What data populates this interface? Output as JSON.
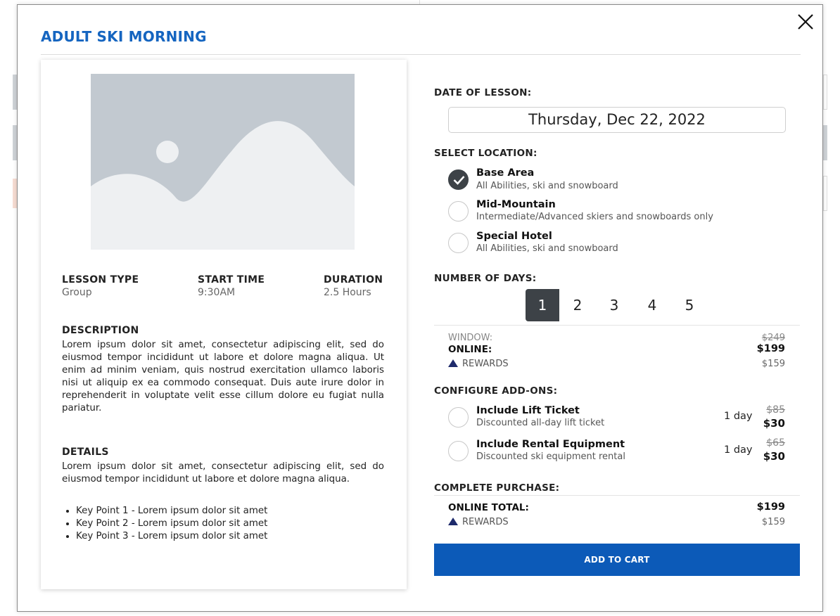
{
  "modal": {
    "title": "ADULT SKI MORNING"
  },
  "lesson": {
    "lesson_type_label": "LESSON TYPE",
    "lesson_type": "Group",
    "start_time_label": "START TIME",
    "start_time": "9:30AM",
    "duration_label": "DURATION",
    "duration": "2.5 Hours",
    "description_label": "DESCRIPTION",
    "description": "Lorem ipsum dolor sit amet, consectetur adipiscing elit, sed do eiusmod tempor incididunt ut labore et dolore magna aliqua. Ut enim ad minim veniam, quis nostrud exercitation ullamco laboris nisi ut aliquip ex ea commodo consequat. Duis aute irure dolor in reprehenderit in voluptate velit esse cillum dolore eu fugiat nulla pariatur.",
    "details_label": "DETAILS",
    "details": "Lorem ipsum dolor sit amet, consectetur adipiscing elit, sed do eiusmod tempor incididunt ut labore et dolore magna aliqua.",
    "key_points": [
      "Key Point 1 - Lorem ipsum dolor sit amet",
      "Key Point 2 - Lorem ipsum dolor sit amet",
      "Key Point 3 - Lorem ipsum dolor sit amet"
    ]
  },
  "date": {
    "label": "DATE OF LESSON:",
    "value": "Thursday, Dec 22, 2022"
  },
  "location": {
    "label": "SELECT LOCATION:",
    "options": [
      {
        "title": "Base Area",
        "subtitle": "All Abilities, ski and snowboard",
        "selected": true
      },
      {
        "title": "Mid-Mountain",
        "subtitle": "Intermediate/Advanced skiers and snowboards only",
        "selected": false
      },
      {
        "title": "Special Hotel",
        "subtitle": "All Abilities, ski and snowboard",
        "selected": false
      }
    ]
  },
  "days": {
    "label": "NUMBER OF DAYS:",
    "options": [
      "1",
      "2",
      "3",
      "4",
      "5"
    ],
    "selected": "1"
  },
  "pricing": {
    "window_label": "WINDOW:",
    "window_price": "$249",
    "online_label": "ONLINE:",
    "online_price": "$199",
    "rewards_label": "REWARDS",
    "rewards_price": "$159"
  },
  "addons": {
    "label": "CONFIGURE ADD-ONS:",
    "items": [
      {
        "title": "Include Lift Ticket",
        "subtitle": "Discounted all-day lift ticket",
        "days": "1 day",
        "old_price": "$85",
        "price": "$30"
      },
      {
        "title": "Include Rental Equipment",
        "subtitle": "Discounted ski equipment rental",
        "days": "1 day",
        "old_price": "$65",
        "price": "$30"
      }
    ]
  },
  "purchase": {
    "label": "COMPLETE PURCHASE:",
    "total_label": "ONLINE TOTAL:",
    "total": "$199",
    "rewards_label": "REWARDS",
    "rewards_total": "$159",
    "button_label": "ADD TO CART"
  },
  "colors": {
    "accent": "#1565c0",
    "button": "#0c5ab8",
    "selected": "#3d4247"
  }
}
